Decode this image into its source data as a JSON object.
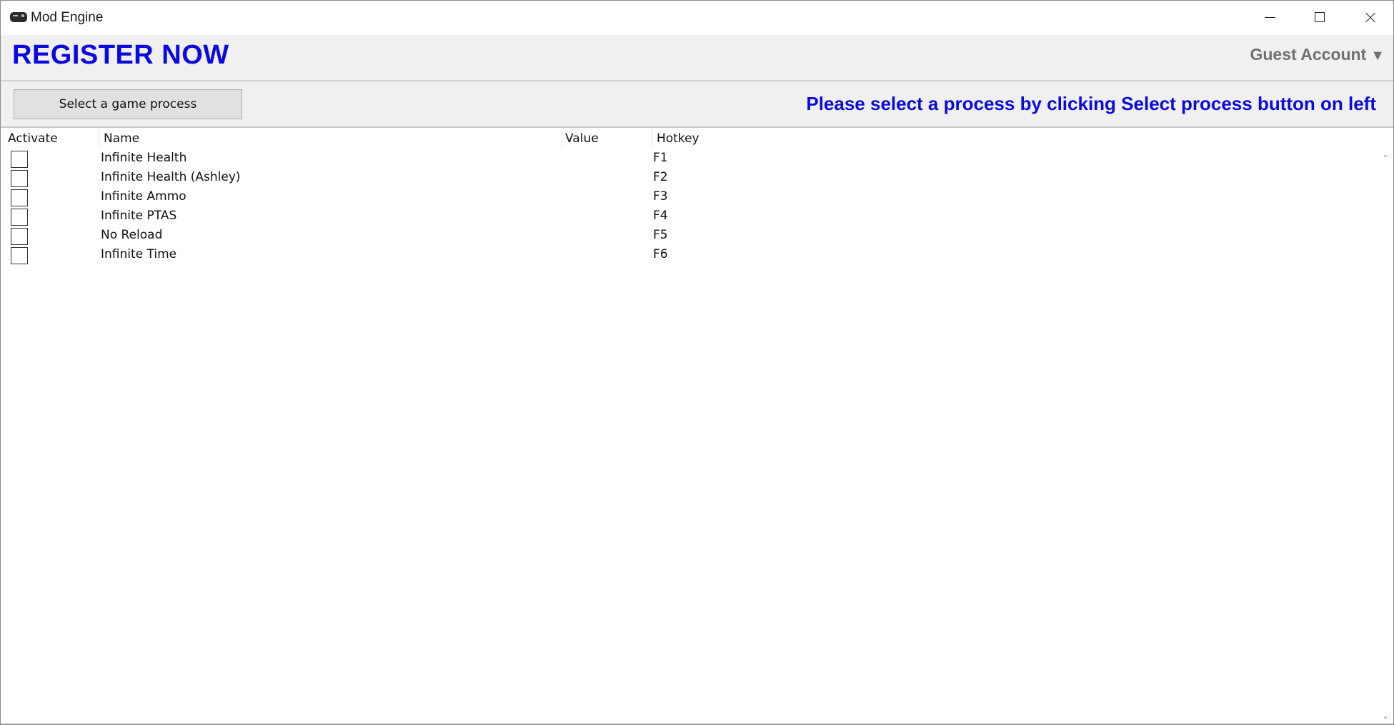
{
  "window": {
    "title": "Mod Engine",
    "app_icon": "gamepad-icon"
  },
  "header": {
    "register_label": "REGISTER NOW",
    "account_label": "Guest Account",
    "account_caret": "▼"
  },
  "process_bar": {
    "select_button_label": "Select a game process",
    "message": "Please select a process by clicking Select process button on left"
  },
  "table": {
    "columns": [
      "Activate",
      "Name",
      "Value",
      "Hotkey"
    ],
    "rows": [
      {
        "name": "Infinite Health",
        "value": "",
        "hotkey": "F1",
        "active": false
      },
      {
        "name": "Infinite Health (Ashley)",
        "value": "",
        "hotkey": "F2",
        "active": false
      },
      {
        "name": "Infinite Ammo",
        "value": "",
        "hotkey": "F3",
        "active": false
      },
      {
        "name": "Infinite PTAS",
        "value": "",
        "hotkey": "F4",
        "active": false
      },
      {
        "name": "No Reload",
        "value": "",
        "hotkey": "F5",
        "active": false
      },
      {
        "name": "Infinite Time",
        "value": "",
        "hotkey": "F6",
        "active": false
      }
    ]
  },
  "scrollbar": {
    "up_glyph": "⌃",
    "down_glyph": "⌄"
  },
  "colors": {
    "accent_blue": "#0a0adf",
    "account_gray": "#707070",
    "bar_background": "#f0f0f0"
  }
}
